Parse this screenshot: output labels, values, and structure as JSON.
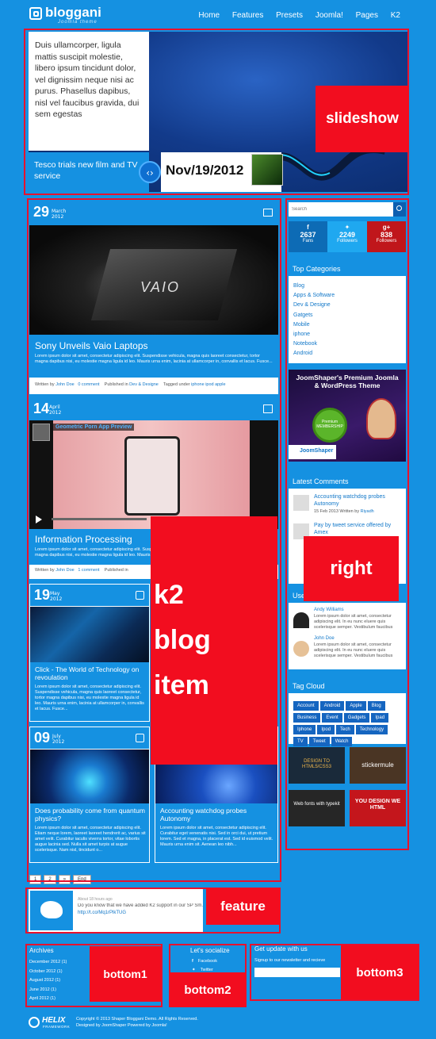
{
  "logo": {
    "name": "bloggani",
    "tagline": "Joomla theme"
  },
  "nav": [
    "Home",
    "Features",
    "Presets",
    "Joomla!",
    "Pages",
    "K2"
  ],
  "slideshow": {
    "text": "Duis ullamcorper, ligula mattis suscipit molestie, libero ipsum tincidunt dolor, vel dignissim neque nisi ac purus. Phasellus dapibus, nisl vel faucibus gravida, dui sem egestas",
    "caption": "Tesco trials new film and TV service",
    "date": "Nov/19/2012",
    "label": "slideshow"
  },
  "posts": [
    {
      "day": "29",
      "month": "March",
      "year": "2012",
      "title": "Sony Unveils Vaio Laptops",
      "body": "Lorem ipsum dolor sit amet, consectetur adipiscing elit. Suspendisse vehicula, magna quis laoreet consectetur, tortor magna dapibus nisi, eu molestie magna ligula id leo. Mauris urna enim, lacinia at ullamcorper in, convallis et lacus. Fusce...",
      "written_by": "Written by",
      "author": "John Doe",
      "comments": "0 comment",
      "published_in": "Published in",
      "category": "Dev & Designe",
      "tagged": "Tagged under",
      "tags": "iphone  ipod  apple"
    },
    {
      "day": "14",
      "month": "April",
      "year": "2012",
      "video_title": "Geometric Porn App Preview",
      "title": "Information Processing",
      "body": "Lorem ipsum dolor sit amet, consectetur adipiscing elit. Suspendisse vehicula, magna quis laoreet consectetur, tortor magna dapibus nisi, eu molestie magna ligula id leo. Mauris urna enim, lacinia at ullamcorper in, convallis et lacus. Fusce sit amet velit...",
      "written_by": "Written by",
      "author": "John Doe",
      "comments": "1 comment",
      "published_in": "Published in"
    }
  ],
  "small_posts": [
    {
      "day": "19",
      "month": "May",
      "year": "2012",
      "title": "Click - The World of Technology on revoulation",
      "body": "Lorem ipsum dolor sit amet, consectetur adipiscing elit. Suspendisse vehicula, magna quis laoreet consectetur, tortor magna dapibus nisi, eu molestie magna ligula id leo. Mauris urna enim, lacinia at ullamcorper in, convallis et lacus. Fusce..."
    },
    {
      "day": "09",
      "month": "July",
      "year": "2012",
      "title": "Does probability come from quantum physics?",
      "body": "Lorem ipsum dolor sit amet, consectetur adipiscing elit. Etiam neque lorem, laoreet laoreet hendrerit ac, varius sit amet velit. Curabitur iaculis viverra tortor, vitae lobortis augue lacinia sed. Nulla sit amet turpis at augue scelerisque. Nam nisl, tincidunt o..."
    },
    {
      "title": "Accounting watchdog probes Autonomy",
      "body": "Lorem ipsum dolor sit amet, consectetur adipiscing elit. Curabitur eget venenatis nisi. Sed in orci dui, ut pretium lorem. Sed et magna, in placerat est. Sed id euismod velit. Mauris urna enim sit. Aenean leo nibh..."
    }
  ],
  "pager": [
    "1",
    "2",
    "»",
    "End"
  ],
  "k2_label": "k2 blog item",
  "right_label": "right",
  "sidebar": {
    "search_placeholder": "Search",
    "social": [
      {
        "count": "2637",
        "label": "Fans",
        "color": "#0d6bb5"
      },
      {
        "count": "2249",
        "label": "Followers",
        "color": "#1fa8f0"
      },
      {
        "count": "838",
        "label": "Followers",
        "color": "#c0161b"
      }
    ],
    "categories_title": "Top Categories",
    "categories": [
      "Blog",
      "Apps & Software",
      "Dev & Designe",
      "Gatgets",
      "Mobile",
      "iphone",
      "Notebook",
      "Android"
    ],
    "ad_title": "JoomShaper's Premium Joomla & WordPress Theme",
    "ad_badge": "Premium MEMBERSHIP",
    "ad_brand": "JoomShaper",
    "comments_title": "Latest Comments",
    "comments": [
      {
        "title": "Accounting watchdog probes Autonomy",
        "meta": "15 Feb 2013 Written by",
        "author": "Riyadh"
      },
      {
        "title": "Pay by tweet service offered by Amex",
        "meta": "",
        "author": ""
      }
    ],
    "users_title": "User",
    "users": [
      {
        "name": "Andy Williams",
        "text": "Lorem ipsum dolor sit amet, consectetur adipiscing elit. In eu nunc eluere quis scelerisque semper. Vestibulum faucibus"
      },
      {
        "name": "John Doe",
        "text": "Lorem ipsum dolor sit amet, consectetur adipiscing elit. In eu nunc eluere quis scelerisque semper. Vestibulum faucibus"
      }
    ],
    "tagcloud_title": "Tag Cloud",
    "tags": [
      "Account",
      "Android",
      "Apple",
      "Blog",
      "Business",
      "Event",
      "Gadgets",
      "Ipad",
      "Iphone",
      "Ipod",
      "Tech",
      "Technology",
      "TV",
      "Tweet",
      "Watch"
    ],
    "ads": [
      "DESIGN TO HTML5/CSS3",
      "stickermule",
      "Web fonts with typekit",
      "YOU DESIGN WE HTML"
    ]
  },
  "feature": {
    "meta": "About 18 hours ago",
    "text": "Do you know that we have added K2 support in our SP Sm...",
    "link": "http://t.co/Mq1rPlkTUG",
    "label": "feature"
  },
  "bottom": {
    "archives_title": "Archives",
    "archives": [
      "December 2012 (1)",
      "October 2012 (1)",
      "August 2012 (1)",
      "June 2012 (1)",
      "April 2012 (1)"
    ],
    "social_title": "Let's socialize",
    "social": [
      "Facebook",
      "Twitter"
    ],
    "newsletter_title": "Get update with us",
    "newsletter_text": "Signup to our newsletter and recieve",
    "labels": [
      "bottom1",
      "bottom2",
      "bottom3"
    ]
  },
  "footer": {
    "brand": "HELIX",
    "brand_sub": "FRAMEWORK",
    "copyright": "Copyright © 2013 Shaper Bloggani Demo. All Rights Reserved.",
    "designed": "Designed by JoomShaper Powered by Joomla!"
  }
}
